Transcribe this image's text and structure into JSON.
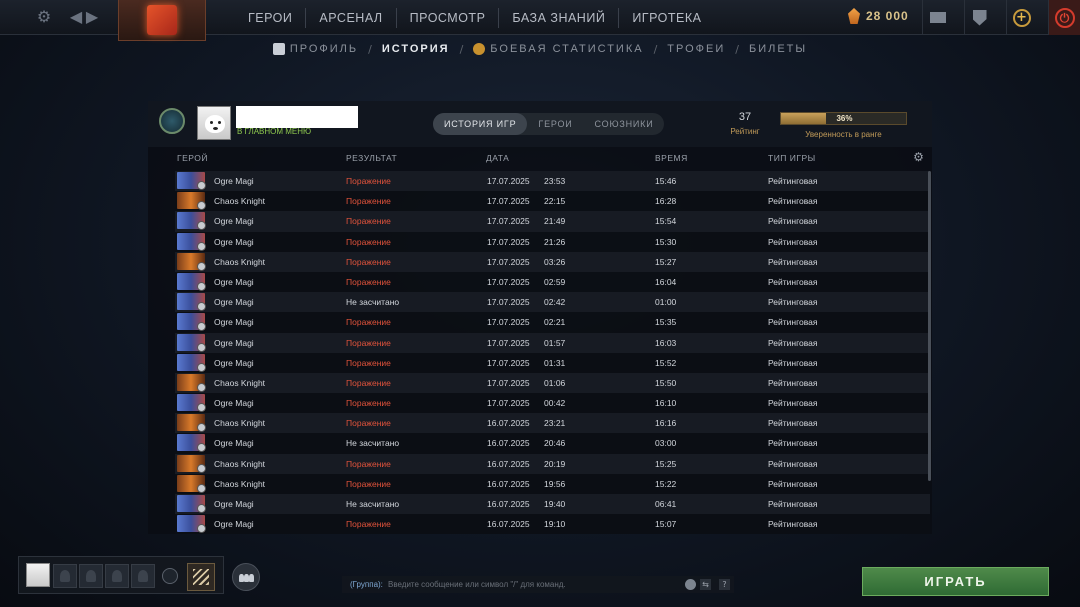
{
  "topbar": {
    "nav": [
      "ГЕРОИ",
      "АРСЕНАЛ",
      "ПРОСМОТР",
      "БАЗА ЗНАНИЙ",
      "ИГРОТЕКА"
    ],
    "gold": "28 000",
    "icons": [
      "gear-icon",
      "back-arrow-icon",
      "forward-arrow-icon",
      "mail-icon",
      "shield-upgrade-icon",
      "plus-badge-icon",
      "power-icon"
    ]
  },
  "subnav": {
    "profile": "ПРОФИЛЬ",
    "history": "ИСТОРИЯ",
    "stats": "БОЕВАЯ СТАТИСТИКА",
    "trophies": "ТРОФЕИ",
    "tickets": "БИЛЕТЫ"
  },
  "profile": {
    "status": "В ГЛАВНОМ МЕНЮ",
    "rating_value": "37",
    "rating_label": "Рейтинг",
    "confidence_pct": "36%",
    "confidence_fraction": 0.36,
    "confidence_label": "Уверенность в ранге"
  },
  "tabs": [
    "ИСТОРИЯ ИГР",
    "ГЕРОИ",
    "СОЮЗНИКИ"
  ],
  "columns": {
    "hero": "ГЕРОЙ",
    "result": "РЕЗУЛЬТАТ",
    "date": "ДАТА",
    "time": "ВРЕМЯ",
    "mode": "ТИП ИГРЫ"
  },
  "matches": [
    {
      "hero": "Ogre Magi",
      "result": "Поражение",
      "date": "17.07.2025",
      "clock": "23:53",
      "duration": "15:46",
      "mode": "Рейтинговая"
    },
    {
      "hero": "Chaos Knight",
      "result": "Поражение",
      "date": "17.07.2025",
      "clock": "22:15",
      "duration": "16:28",
      "mode": "Рейтинговая"
    },
    {
      "hero": "Ogre Magi",
      "result": "Поражение",
      "date": "17.07.2025",
      "clock": "21:49",
      "duration": "15:54",
      "mode": "Рейтинговая"
    },
    {
      "hero": "Ogre Magi",
      "result": "Поражение",
      "date": "17.07.2025",
      "clock": "21:26",
      "duration": "15:30",
      "mode": "Рейтинговая"
    },
    {
      "hero": "Chaos Knight",
      "result": "Поражение",
      "date": "17.07.2025",
      "clock": "03:26",
      "duration": "15:27",
      "mode": "Рейтинговая"
    },
    {
      "hero": "Ogre Magi",
      "result": "Поражение",
      "date": "17.07.2025",
      "clock": "02:59",
      "duration": "16:04",
      "mode": "Рейтинговая"
    },
    {
      "hero": "Ogre Magi",
      "result": "Не засчитано",
      "date": "17.07.2025",
      "clock": "02:42",
      "duration": "01:00",
      "mode": "Рейтинговая"
    },
    {
      "hero": "Ogre Magi",
      "result": "Поражение",
      "date": "17.07.2025",
      "clock": "02:21",
      "duration": "15:35",
      "mode": "Рейтинговая"
    },
    {
      "hero": "Ogre Magi",
      "result": "Поражение",
      "date": "17.07.2025",
      "clock": "01:57",
      "duration": "16:03",
      "mode": "Рейтинговая"
    },
    {
      "hero": "Ogre Magi",
      "result": "Поражение",
      "date": "17.07.2025",
      "clock": "01:31",
      "duration": "15:52",
      "mode": "Рейтинговая"
    },
    {
      "hero": "Chaos Knight",
      "result": "Поражение",
      "date": "17.07.2025",
      "clock": "01:06",
      "duration": "15:50",
      "mode": "Рейтинговая"
    },
    {
      "hero": "Ogre Magi",
      "result": "Поражение",
      "date": "17.07.2025",
      "clock": "00:42",
      "duration": "16:10",
      "mode": "Рейтинговая"
    },
    {
      "hero": "Chaos Knight",
      "result": "Поражение",
      "date": "16.07.2025",
      "clock": "23:21",
      "duration": "16:16",
      "mode": "Рейтинговая"
    },
    {
      "hero": "Ogre Magi",
      "result": "Не засчитано",
      "date": "16.07.2025",
      "clock": "20:46",
      "duration": "03:00",
      "mode": "Рейтинговая"
    },
    {
      "hero": "Chaos Knight",
      "result": "Поражение",
      "date": "16.07.2025",
      "clock": "20:19",
      "duration": "15:25",
      "mode": "Рейтинговая"
    },
    {
      "hero": "Chaos Knight",
      "result": "Поражение",
      "date": "16.07.2025",
      "clock": "19:56",
      "duration": "15:22",
      "mode": "Рейтинговая"
    },
    {
      "hero": "Ogre Magi",
      "result": "Не засчитано",
      "date": "16.07.2025",
      "clock": "19:40",
      "duration": "06:41",
      "mode": "Рейтинговая"
    },
    {
      "hero": "Ogre Magi",
      "result": "Поражение",
      "date": "16.07.2025",
      "clock": "19:10",
      "duration": "15:07",
      "mode": "Рейтинговая"
    }
  ],
  "colors": {
    "loss": "#e2533b",
    "neutral": "#d3d7dd",
    "play": "#3f7d3f",
    "status": "#8fc94f"
  },
  "chat": {
    "prefix": "(Группа):",
    "placeholder": "Введите сообщение или символ \"/\" для команд."
  },
  "play_label": "ИГРАТЬ"
}
